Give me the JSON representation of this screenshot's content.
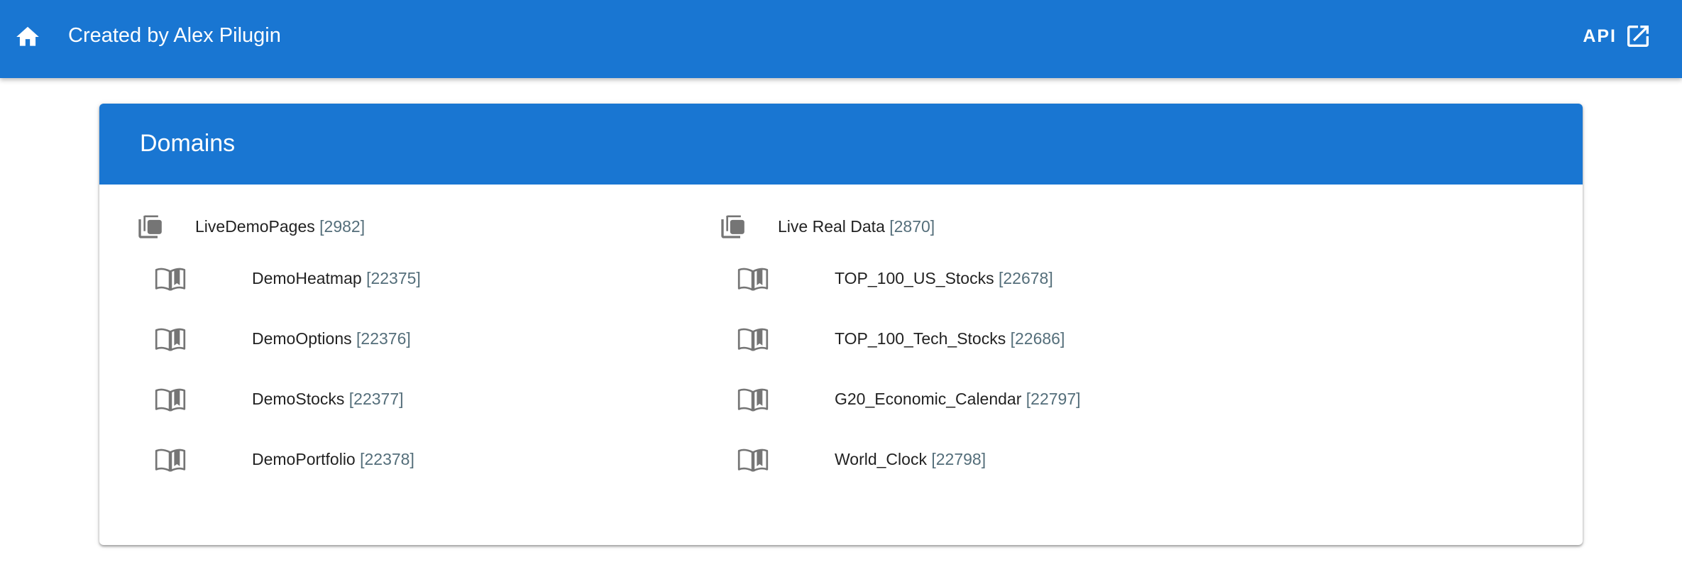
{
  "appbar": {
    "title": "Created by Alex Pilugin",
    "api_label": "API",
    "home_icon": "home-icon",
    "external_icon": "open-in-new-icon",
    "bg_color": "#1976d2"
  },
  "card": {
    "title": "Domains"
  },
  "domains": [
    {
      "name": "LiveDemoPages",
      "id": "[2982]",
      "icon": "library-icon",
      "pages": [
        {
          "name": "DemoHeatmap",
          "id": "[22375]",
          "icon": "book-open-icon"
        },
        {
          "name": "DemoOptions",
          "id": "[22376]",
          "icon": "book-open-icon"
        },
        {
          "name": "DemoStocks",
          "id": "[22377]",
          "icon": "book-open-icon"
        },
        {
          "name": "DemoPortfolio",
          "id": "[22378]",
          "icon": "book-open-icon"
        }
      ]
    },
    {
      "name": "Live Real Data",
      "id": "[2870]",
      "icon": "library-icon",
      "pages": [
        {
          "name": "TOP_100_US_Stocks",
          "id": "[22678]",
          "icon": "book-open-icon"
        },
        {
          "name": "TOP_100_Tech_Stocks",
          "id": "[22686]",
          "icon": "book-open-icon"
        },
        {
          "name": "G20_Economic_Calendar",
          "id": "[22797]",
          "icon": "book-open-icon"
        },
        {
          "name": "World_Clock",
          "id": "[22798]",
          "icon": "book-open-icon"
        }
      ]
    }
  ]
}
